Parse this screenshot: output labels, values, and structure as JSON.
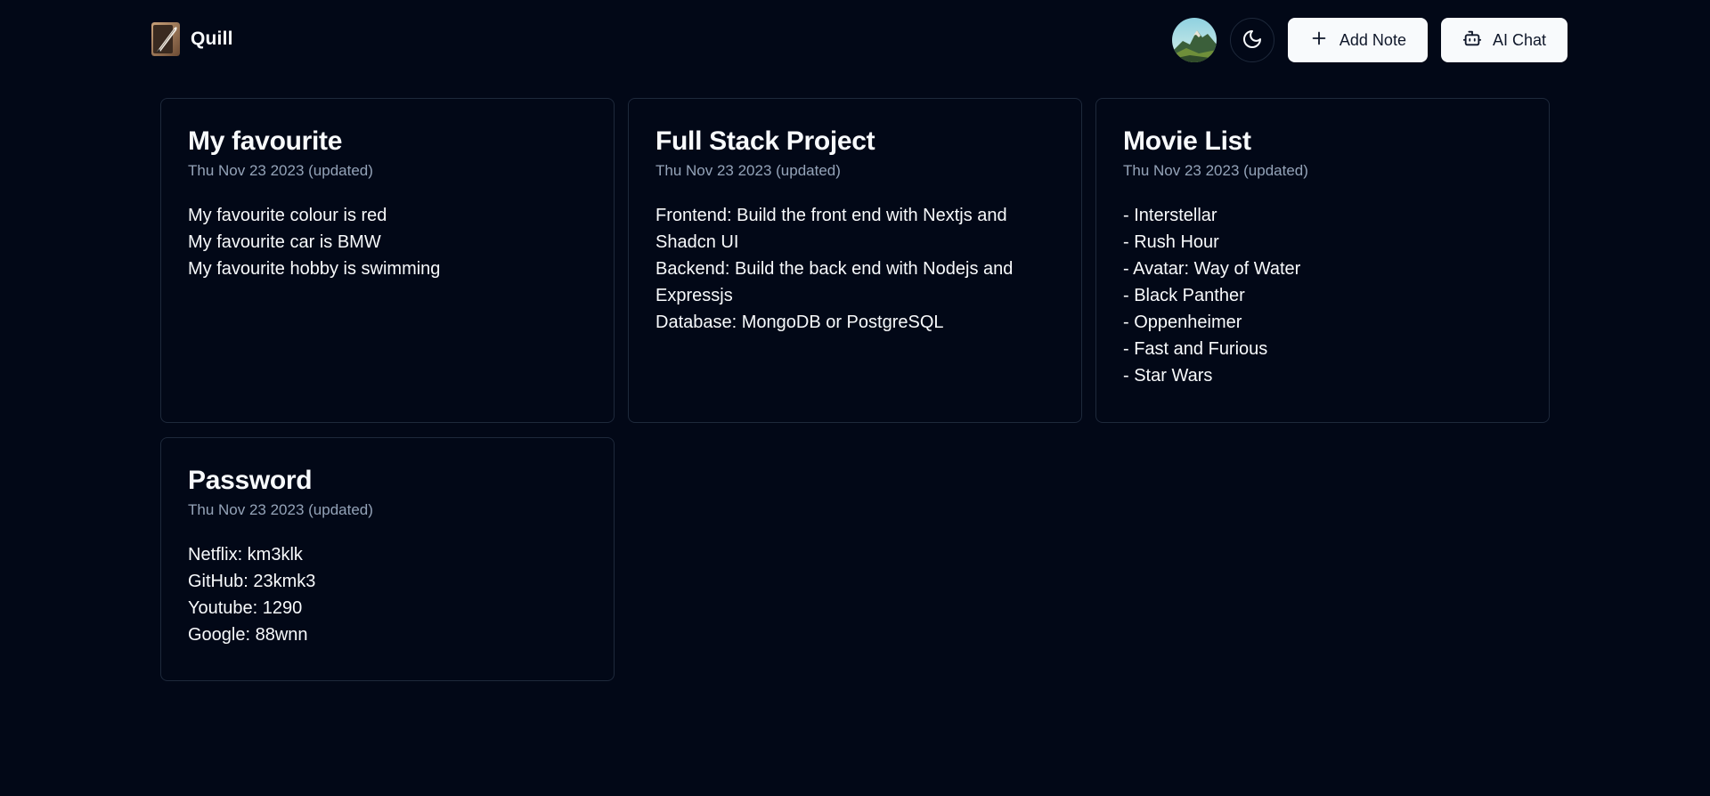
{
  "app": {
    "name": "Quill"
  },
  "header": {
    "avatar_icon": "landscape-avatar",
    "theme_icon": "moon-icon",
    "add_note_label": "Add Note",
    "ai_chat_label": "AI Chat"
  },
  "colors": {
    "background": "#020817",
    "card_border": "#1e293b",
    "text": "#f8fafc",
    "muted": "#94a3b8",
    "button_bg": "#f8fafc",
    "button_text": "#0f172a"
  },
  "notes": [
    {
      "title": "My favourite",
      "date": "Thu Nov 23 2023 (updated)",
      "lines": [
        "My favourite colour is red",
        "My favourite car is BMW",
        "My favourite hobby is swimming"
      ]
    },
    {
      "title": "Full Stack Project",
      "date": "Thu Nov 23 2023 (updated)",
      "lines": [
        "Frontend: Build the front end with Nextjs and",
        "Shadcn UI",
        "Backend: Build the back end with Nodejs and",
        "Expressjs",
        "Database: MongoDB or PostgreSQL"
      ]
    },
    {
      "title": "Movie List",
      "date": "Thu Nov 23 2023 (updated)",
      "lines": [
        "- Interstellar",
        "- Rush Hour",
        "- Avatar: Way of Water",
        "- Black Panther",
        "- Oppenheimer",
        "- Fast and Furious",
        "- Star Wars"
      ]
    },
    {
      "title": "Password",
      "date": "Thu Nov 23 2023 (updated)",
      "lines": [
        "Netflix: km3klk",
        "GitHub: 23kmk3",
        "Youtube: 1290",
        "Google: 88wnn"
      ]
    }
  ]
}
